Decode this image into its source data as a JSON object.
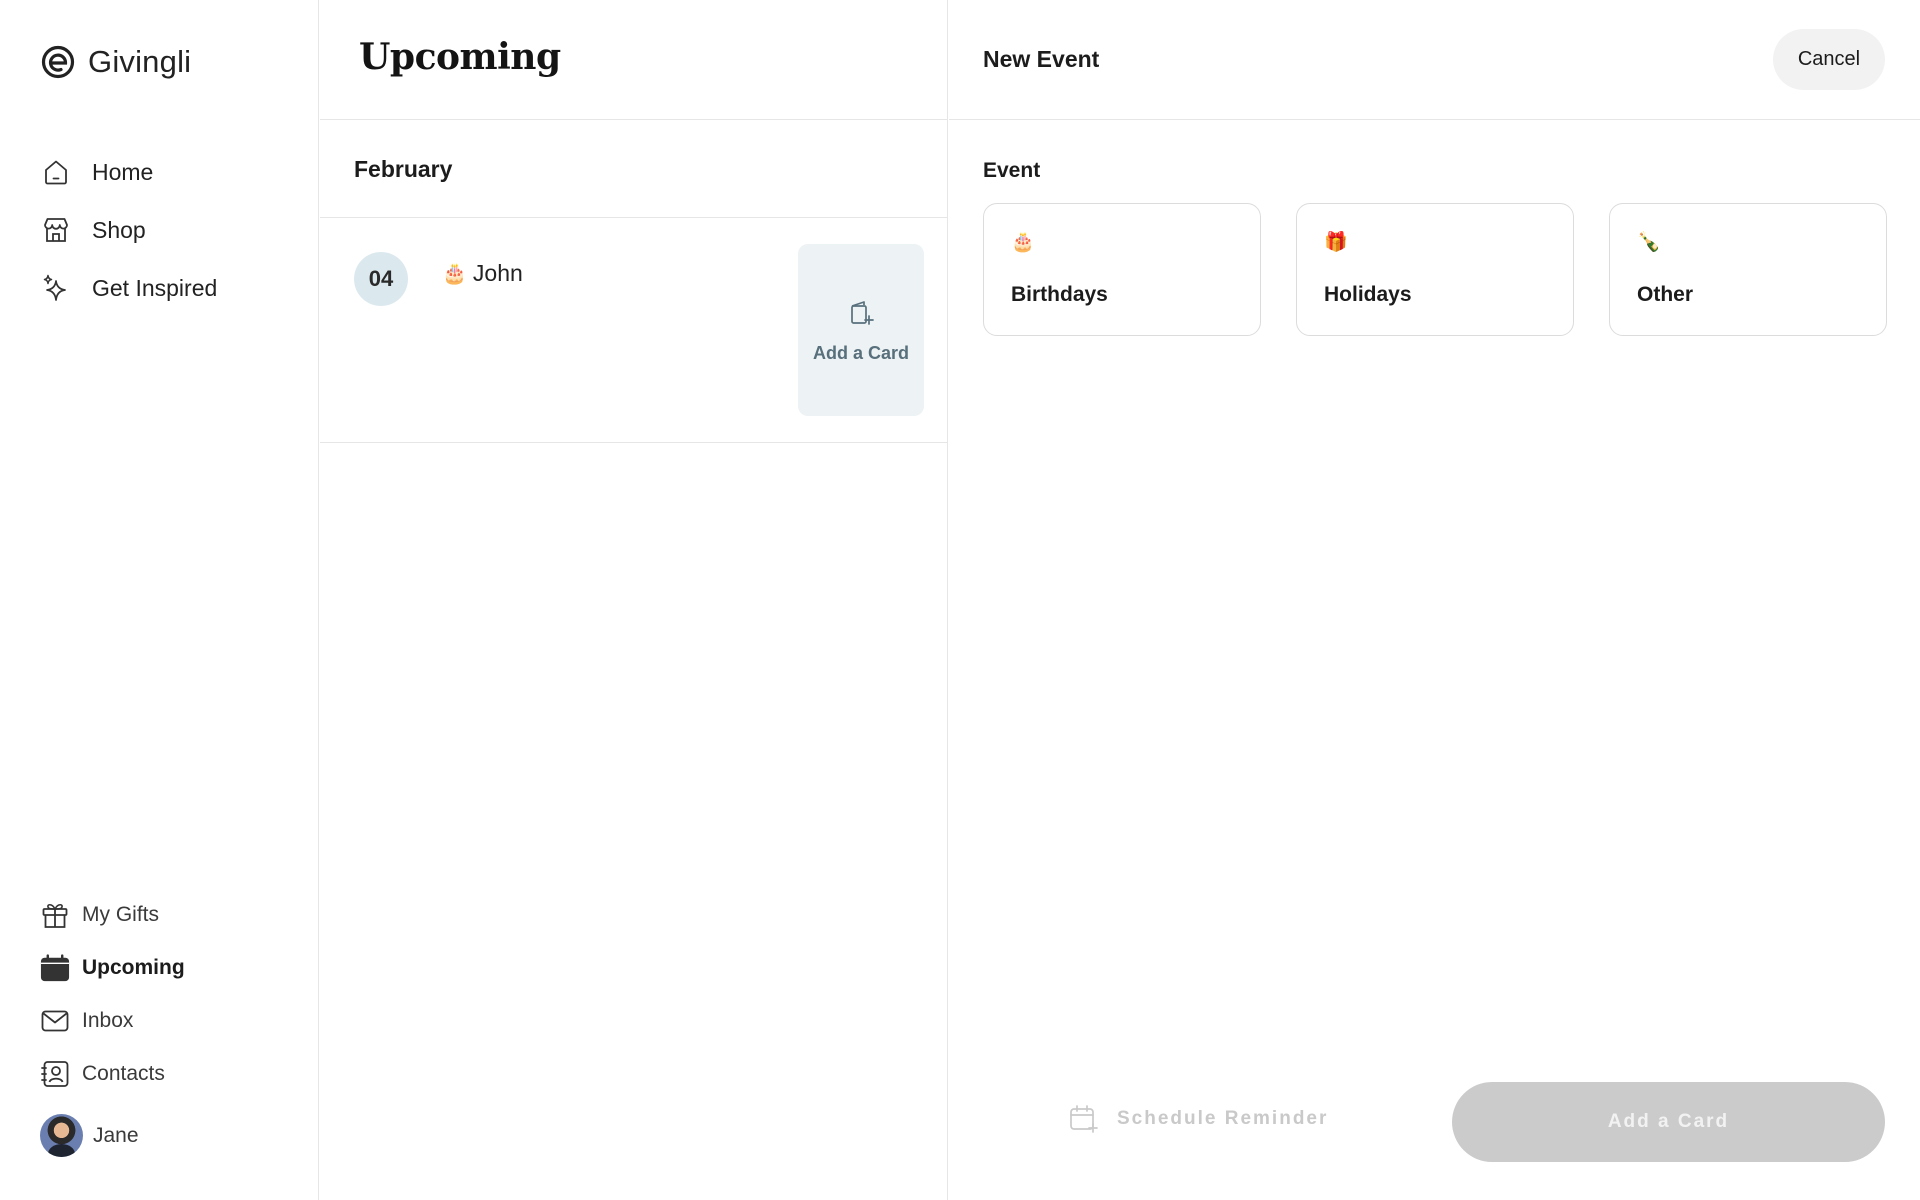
{
  "app": {
    "name": "Givingli"
  },
  "sidebar": {
    "nav_top": [
      {
        "label": "Home",
        "icon": "home-icon"
      },
      {
        "label": "Shop",
        "icon": "shop-icon"
      },
      {
        "label": "Get Inspired",
        "icon": "sparkle-icon"
      }
    ],
    "nav_bottom": [
      {
        "label": "My Gifts",
        "icon": "gift-icon"
      },
      {
        "label": "Upcoming",
        "icon": "calendar-icon",
        "active": true
      },
      {
        "label": "Inbox",
        "icon": "mail-icon"
      },
      {
        "label": "Contacts",
        "icon": "contacts-icon"
      }
    ],
    "user": {
      "name": "Jane"
    }
  },
  "upcoming": {
    "title": "Upcoming",
    "month": "February",
    "events": [
      {
        "day": "04",
        "emoji": "🎂",
        "name": "John",
        "action_label": "Add a Card"
      }
    ]
  },
  "new_event": {
    "title": "New Event",
    "cancel_label": "Cancel",
    "section_label": "Event",
    "types": [
      {
        "emoji": "🎂",
        "label": "Birthdays"
      },
      {
        "emoji": "🎁",
        "label": "Holidays"
      },
      {
        "emoji": "🍾",
        "label": "Other"
      }
    ],
    "schedule_label": "Schedule Reminder",
    "primary_label": "Add a Card"
  },
  "colors": {
    "accent_badge": "#dbe9ef",
    "tile_bg": "#edf2f4",
    "tile_text": "#58707c",
    "disabled_button": "#cbcbcb",
    "divider": "#e6e6e6"
  }
}
